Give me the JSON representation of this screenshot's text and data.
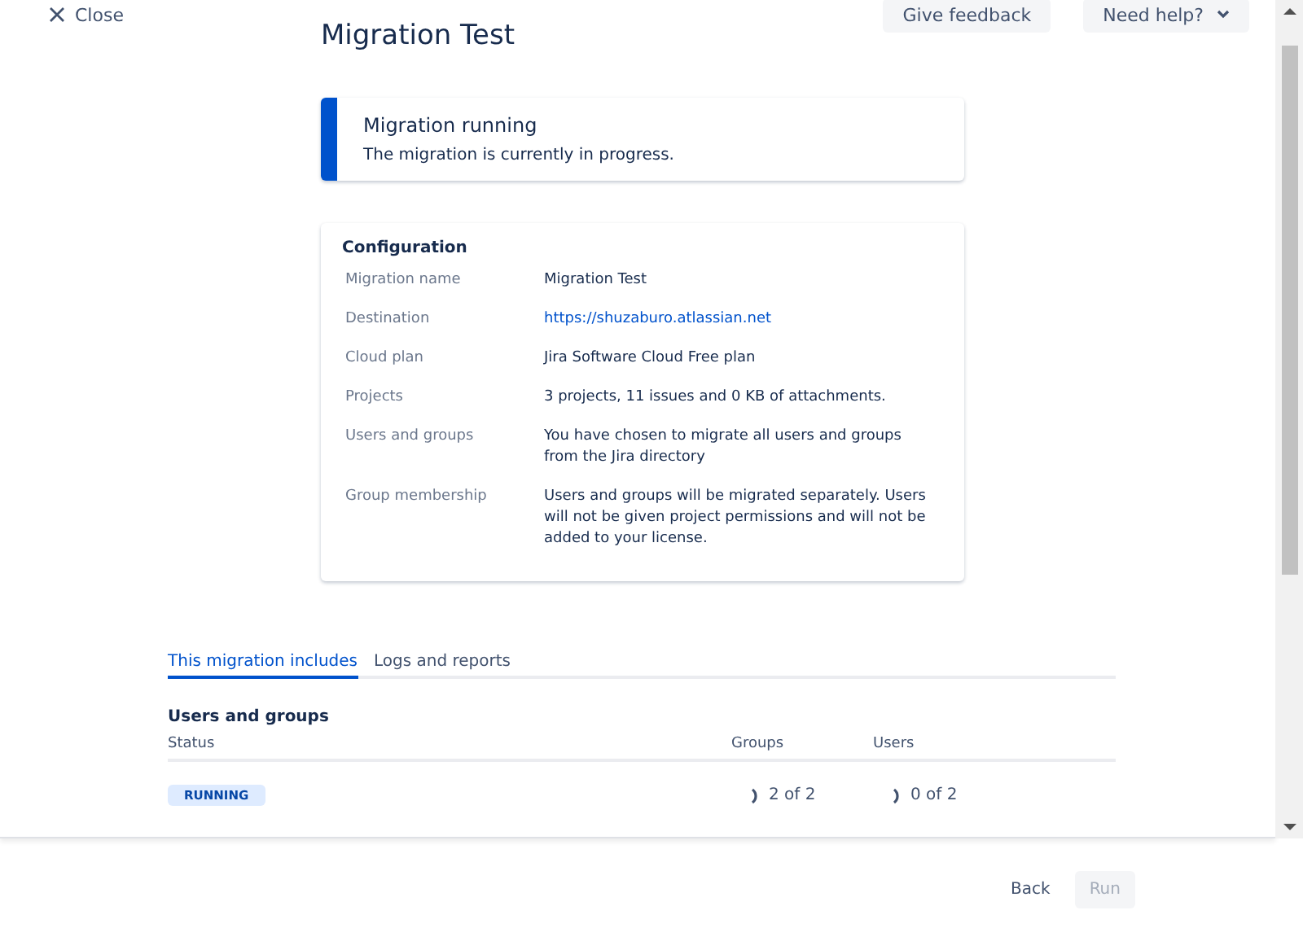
{
  "header": {
    "close": "Close",
    "feedback": "Give feedback",
    "help": "Need help?"
  },
  "title": "Migration Test",
  "banner": {
    "title": "Migration running",
    "message": "The migration is currently in progress."
  },
  "configuration": {
    "heading": "Configuration",
    "rows": [
      {
        "label": "Migration name",
        "value": "Migration Test",
        "kind": "text"
      },
      {
        "label": "Destination",
        "value": "https://shuzaburo.atlassian.net",
        "kind": "link"
      },
      {
        "label": "Cloud plan",
        "value": "Jira Software Cloud Free plan",
        "kind": "text"
      },
      {
        "label": "Projects",
        "value": "3 projects, 11 issues and 0 KB of attachments.",
        "kind": "text"
      },
      {
        "label": "Users and groups",
        "value": "You have chosen to migrate all users and groups from the Jira directory",
        "kind": "text"
      },
      {
        "label": "Group membership",
        "value": "Users and groups will be migrated separately. Users will not be given project permissions and will not be added to your license.",
        "kind": "text"
      }
    ]
  },
  "tabs": [
    {
      "label": "This migration includes",
      "selected": true
    },
    {
      "label": "Logs and reports",
      "selected": false
    }
  ],
  "section": {
    "heading": "Users and groups",
    "columns": [
      "Status",
      "Groups",
      "Users"
    ],
    "rows": [
      {
        "status": "RUNNING",
        "groups": "2 of 2",
        "users": "0 of 2"
      }
    ]
  },
  "footer": {
    "back": "Back",
    "run": "Run",
    "run_disabled": true
  }
}
